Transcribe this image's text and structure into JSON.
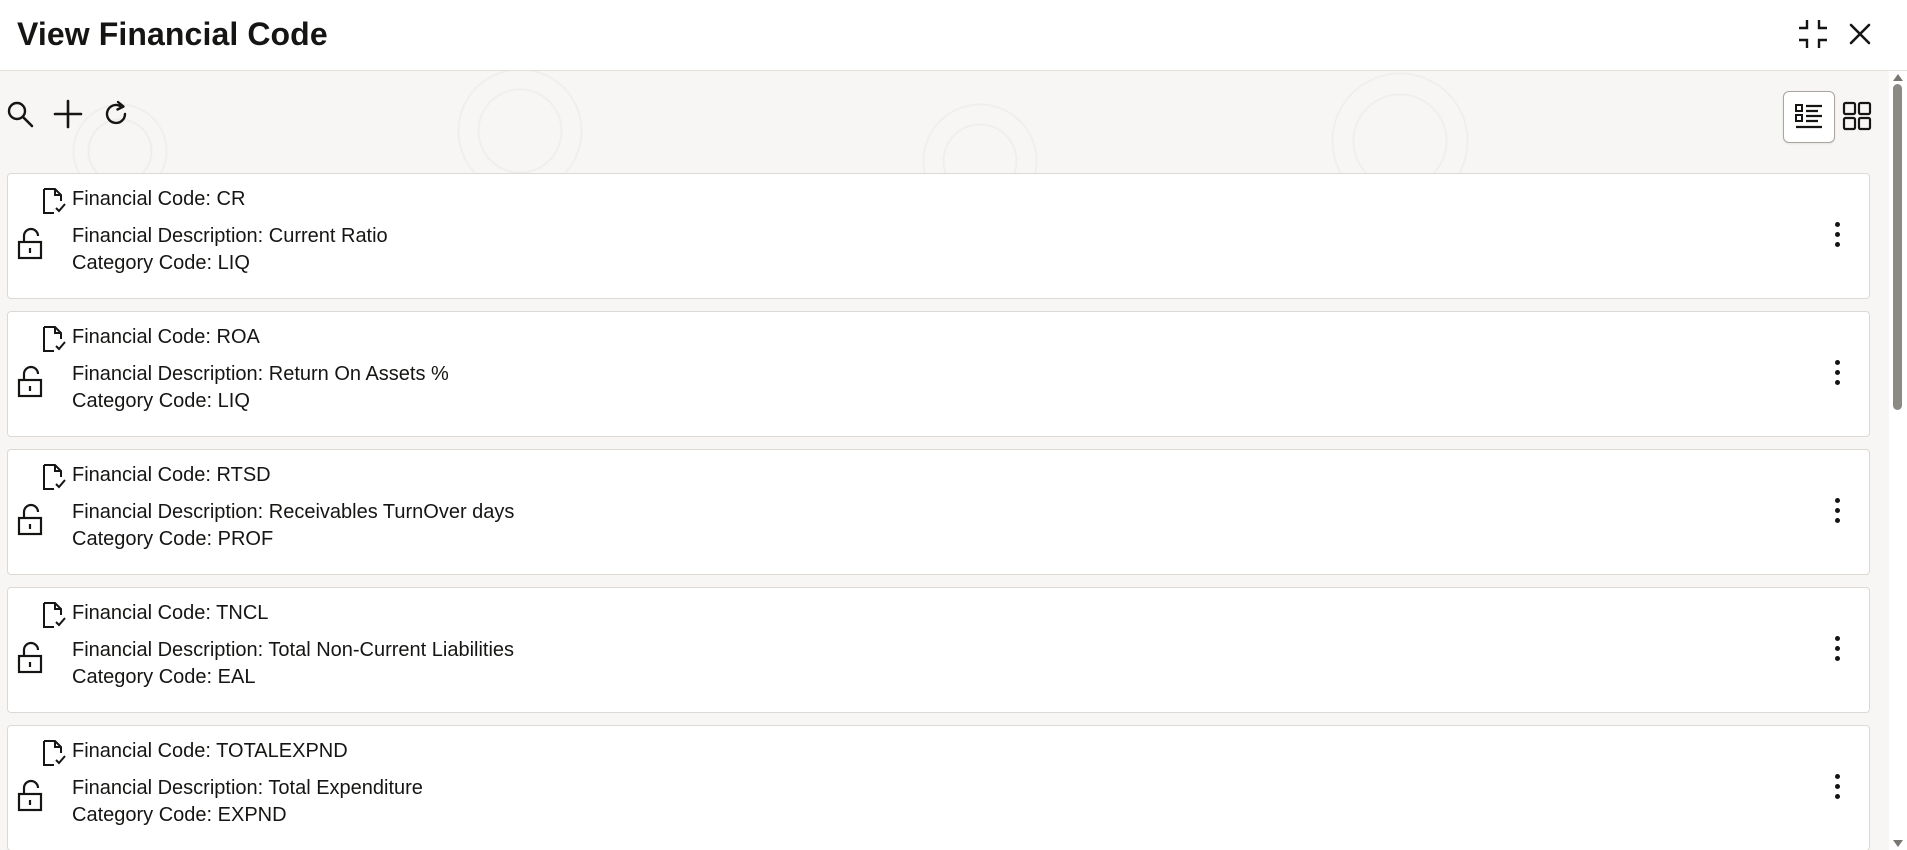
{
  "window": {
    "title": "View Financial Code"
  },
  "header_icons": {
    "minimize": "minimize-icon",
    "close": "close-icon"
  },
  "toolbar": {
    "search": "search-icon",
    "add": "plus-icon",
    "refresh": "refresh-icon",
    "list_view": "list-view-icon",
    "tile_view": "grid-view-icon",
    "active_view": "list"
  },
  "records": [
    {
      "code": "Financial Code: CR",
      "description": "Financial Description: Current Ratio",
      "category": "Category Code: LIQ"
    },
    {
      "code": "Financial Code: ROA",
      "description": "Financial Description: Return On Assets %",
      "category": "Category Code: LIQ"
    },
    {
      "code": "Financial Code: RTSD",
      "description": "Financial Description: Receivables TurnOver days",
      "category": "Category Code: PROF"
    },
    {
      "code": "Financial Code: TNCL",
      "description": "Financial Description: Total Non-Current Liabilities",
      "category": "Category Code: EAL"
    },
    {
      "code": "Financial Code: TOTALEXPND",
      "description": "Financial Description: Total Expenditure",
      "category": "Category Code: EXPND"
    }
  ],
  "colors": {
    "text": "#161513",
    "background": "#f7f6f5",
    "card_border": "#dcd9d5"
  }
}
